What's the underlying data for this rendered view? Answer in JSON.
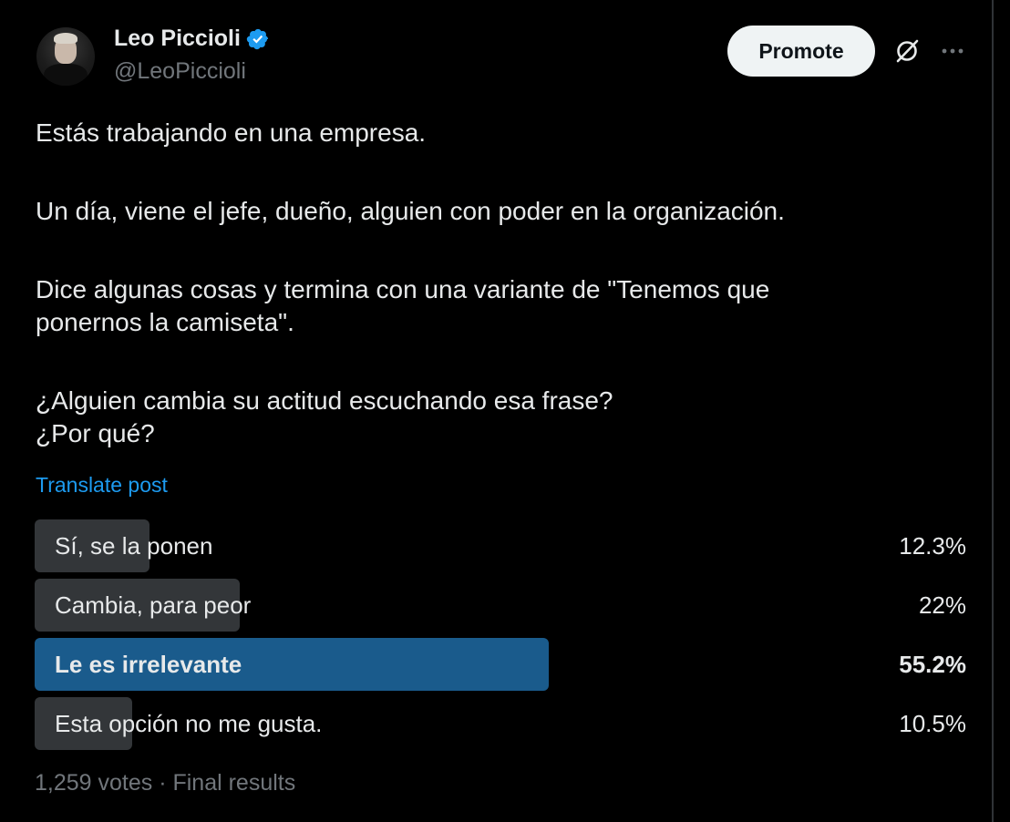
{
  "author": {
    "display_name": "Leo Piccioli",
    "handle": "@LeoPiccioli",
    "verified": true
  },
  "actions": {
    "promote_label": "Promote",
    "grok_icon": "grok-icon",
    "more_icon": "more-options-icon"
  },
  "tweet": {
    "paragraphs": [
      [
        "Estás trabajando en una empresa."
      ],
      [
        "Un día, viene el jefe, dueño, alguien con poder en la organización."
      ],
      [
        "Dice algunas cosas y termina con una variante de \"Tenemos que",
        "ponernos la camiseta\"."
      ],
      [
        "¿Alguien cambia su actitud escuchando esa frase?",
        "¿Por qué?"
      ]
    ],
    "translate_label": "Translate post"
  },
  "poll": {
    "options": [
      {
        "label": "Sí, se la ponen",
        "percent_label": "12.3%",
        "percent": 12.3,
        "winner": false
      },
      {
        "label": "Cambia, para peor",
        "percent_label": "22%",
        "percent": 22,
        "winner": false
      },
      {
        "label": "Le es irrelevante",
        "percent_label": "55.2%",
        "percent": 55.2,
        "winner": true
      },
      {
        "label": "Esta opción no me gusta.",
        "percent_label": "10.5%",
        "percent": 10.5,
        "winner": false
      }
    ],
    "footer": "1,259 votes · Final results"
  },
  "colors": {
    "background": "#000000",
    "text": "#e7e9ea",
    "muted": "#71767b",
    "link": "#1d9bf0",
    "verified": "#1d9bf0",
    "poll_bar": "#333639",
    "poll_winner": "#1a5b8c"
  }
}
